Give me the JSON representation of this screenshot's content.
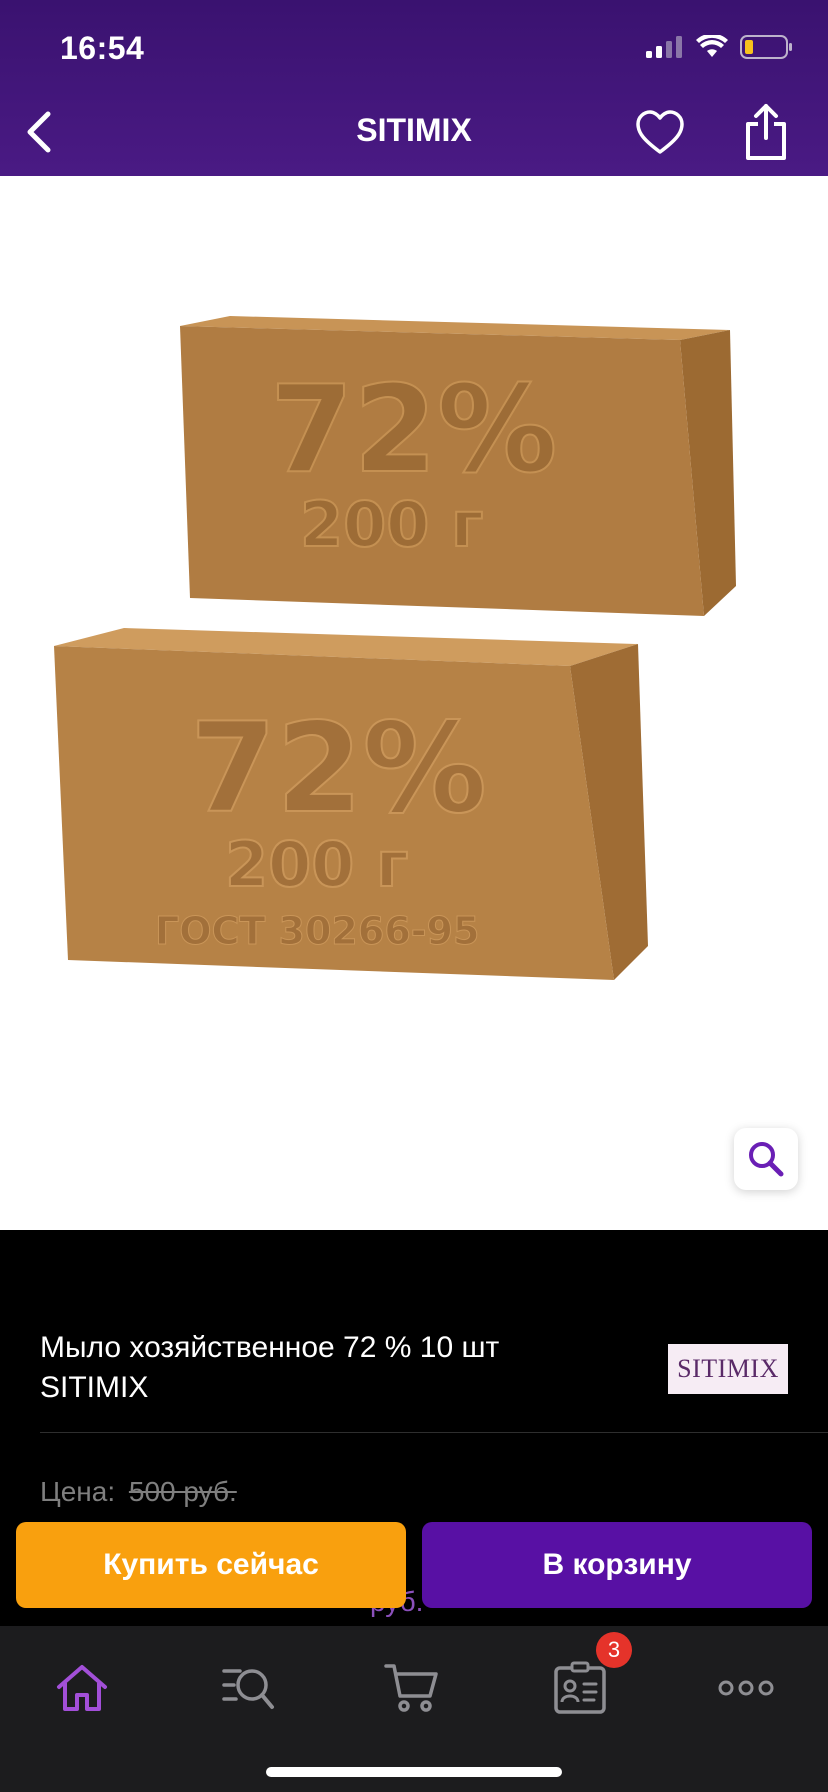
{
  "status_bar": {
    "time": "16:54",
    "signal_icon": "cellular-signal-icon",
    "wifi_icon": "wifi-icon",
    "battery_icon": "battery-low-icon"
  },
  "nav": {
    "title": "SITIMIX",
    "back_icon": "chevron-left-icon",
    "favorite_icon": "heart-outline-icon",
    "share_icon": "share-icon"
  },
  "product_image": {
    "bar_front": {
      "percent": "72%",
      "weight": "200 г",
      "standard": "ГОСТ 30266-95"
    },
    "bar_back": {
      "percent": "72%",
      "weight": "200 г"
    },
    "zoom_icon": "magnifier-icon"
  },
  "product": {
    "title": "Мыло хозяйственное 72 % 10 шт SITIMIX",
    "brand_logo_text": "SITIMIX",
    "price_label": "Цена:",
    "price_old": "500 руб.",
    "bonus_text": "руб."
  },
  "actions": {
    "buy_now": "Купить сейчас",
    "add_to_cart": "В корзину"
  },
  "tabbar": {
    "items": [
      {
        "name": "home",
        "icon": "home-icon",
        "active": true
      },
      {
        "name": "catalog-search",
        "icon": "search-list-icon",
        "active": false
      },
      {
        "name": "cart",
        "icon": "cart-icon",
        "active": false
      },
      {
        "name": "profile",
        "icon": "profile-card-icon",
        "active": false
      },
      {
        "name": "more",
        "icon": "more-dots-icon",
        "active": false
      }
    ],
    "profile_badge": "3"
  },
  "colors": {
    "header_purple": "#4a1a84",
    "accent_orange": "#f9a00e",
    "accent_purple": "#5810a4",
    "badge_red": "#e5332a",
    "active_tab": "#a24fd8"
  }
}
